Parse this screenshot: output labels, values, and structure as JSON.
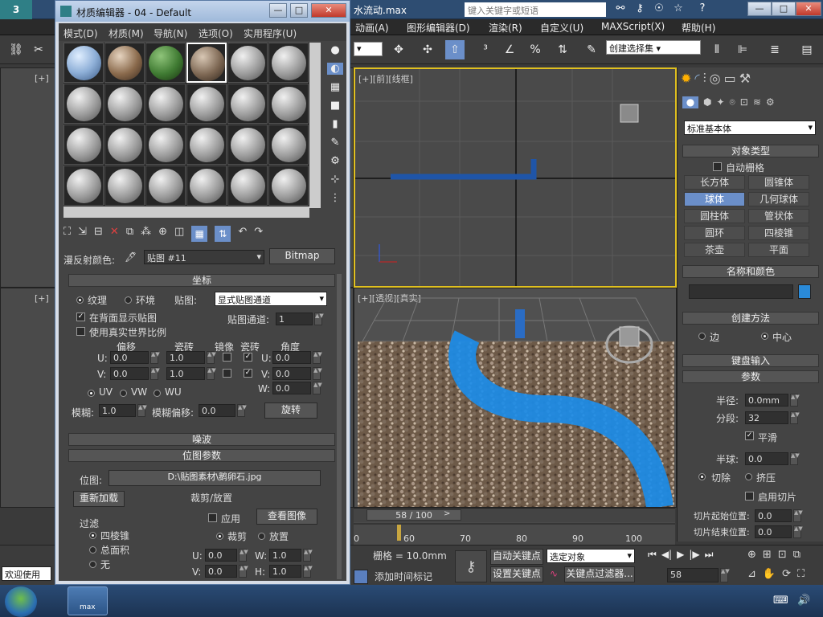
{
  "app": {
    "title": "水流动.max",
    "search_placeholder": "键入关键字或短语",
    "logo_text": "3"
  },
  "menu": [
    "动画(A)",
    "图形编辑器(D)",
    "渲染(R)",
    "自定义(U)",
    "MAXScript(X)",
    "帮助(H)"
  ],
  "toolbar": {
    "selection_set": "创建选择集"
  },
  "viewports": {
    "front_label": "[+][前][线框]",
    "persp_label": "[+][透视][真实]",
    "left_label1": "[+]",
    "left_label2": "[+]"
  },
  "command_panel": {
    "category": "标准基本体",
    "object_type_title": "对象类型",
    "autogrid": "自动栅格",
    "objects": [
      "长方体",
      "圆锥体",
      "球体",
      "几何球体",
      "圆柱体",
      "管状体",
      "圆环",
      "四棱锥",
      "茶壶",
      "平面"
    ],
    "name_color_title": "名称和颜色",
    "creation_method_title": "创建方法",
    "method_edge": "边",
    "method_center": "中心",
    "keyboard_entry": "键盘输入",
    "params_title": "参数",
    "radius_label": "半径:",
    "radius_value": "0.0mm",
    "segments_label": "分段:",
    "segments_value": "32",
    "smooth": "平滑",
    "hemisphere_label": "半球:",
    "hemisphere_value": "0.0",
    "chop": "切除",
    "squash": "挤压",
    "enable_slice": "启用切片",
    "slice_from": "切片起始位置:",
    "slice_from_value": "0.0",
    "slice_to": "切片结束位置:",
    "slice_to_value": "0.0"
  },
  "material_editor": {
    "title": "材质编辑器 - 04 - Default",
    "menu": [
      "模式(D)",
      "材质(M)",
      "导航(N)",
      "选项(O)",
      "实用程序(U)"
    ],
    "diffuse_label": "漫反射颜色:",
    "map_name": "贴图 #11",
    "map_type": "Bitmap",
    "coords_title": "坐标",
    "texture": "纹理",
    "environ": "环境",
    "mapping_label": "贴图:",
    "mapping_value": "显式贴图通道",
    "show_map_back": "在背面显示贴图",
    "map_channel_label": "贴图通道:",
    "map_channel_value": "1",
    "real_world": "使用真实世界比例",
    "offset": "偏移",
    "tiling": "瓷砖",
    "mirror": "镜像",
    "tile": "瓷砖",
    "angle": "角度",
    "u_label": "U:",
    "v_label": "V:",
    "w_label": "W:",
    "u_offset": "0.0",
    "v_offset": "0.0",
    "u_tiling": "1.0",
    "v_tiling": "1.0",
    "u_angle": "0.0",
    "v_angle": "0.0",
    "w_angle": "0.0",
    "uv": "UV",
    "vw": "VW",
    "wu": "WU",
    "blur_label": "模糊:",
    "blur_value": "1.0",
    "blur_offset_label": "模糊偏移:",
    "blur_offset_value": "0.0",
    "rotate": "旋转",
    "noise_title": "噪波",
    "bitmap_params_title": "位图参数",
    "bitmap_label": "位图:",
    "bitmap_path": "D:\\贴图素材\\鹅卵石.jpg",
    "reload": "重新加载",
    "crop_place": "裁剪/放置",
    "filter": "过滤",
    "filter_pyramidal": "四棱锥",
    "filter_sat": "总面积",
    "filter_none": "无",
    "apply": "应用",
    "view_image": "查看图像",
    "crop": "裁剪",
    "place": "放置",
    "crop_u": "0.0",
    "crop_v": "0.0",
    "crop_w": "1.0",
    "crop_h": "1.0",
    "w_label2": "W:",
    "h_label": "H:"
  },
  "timeline": {
    "frame": "58 / 100",
    "ticks": [
      "60",
      "70",
      "80",
      "90",
      "100"
    ],
    "prefix_tick": "0"
  },
  "bottom": {
    "welcome": "欢迎使用",
    "grid": "栅格 = 10.0mm",
    "add_time_tag": "添加时间标记",
    "auto_key": "自动关键点",
    "set_key": "设置关键点",
    "selected_object": "选定对象",
    "key_filters": "关键点过滤器...",
    "current_frame": "58"
  },
  "taskbar": {
    "app_label": "max"
  }
}
